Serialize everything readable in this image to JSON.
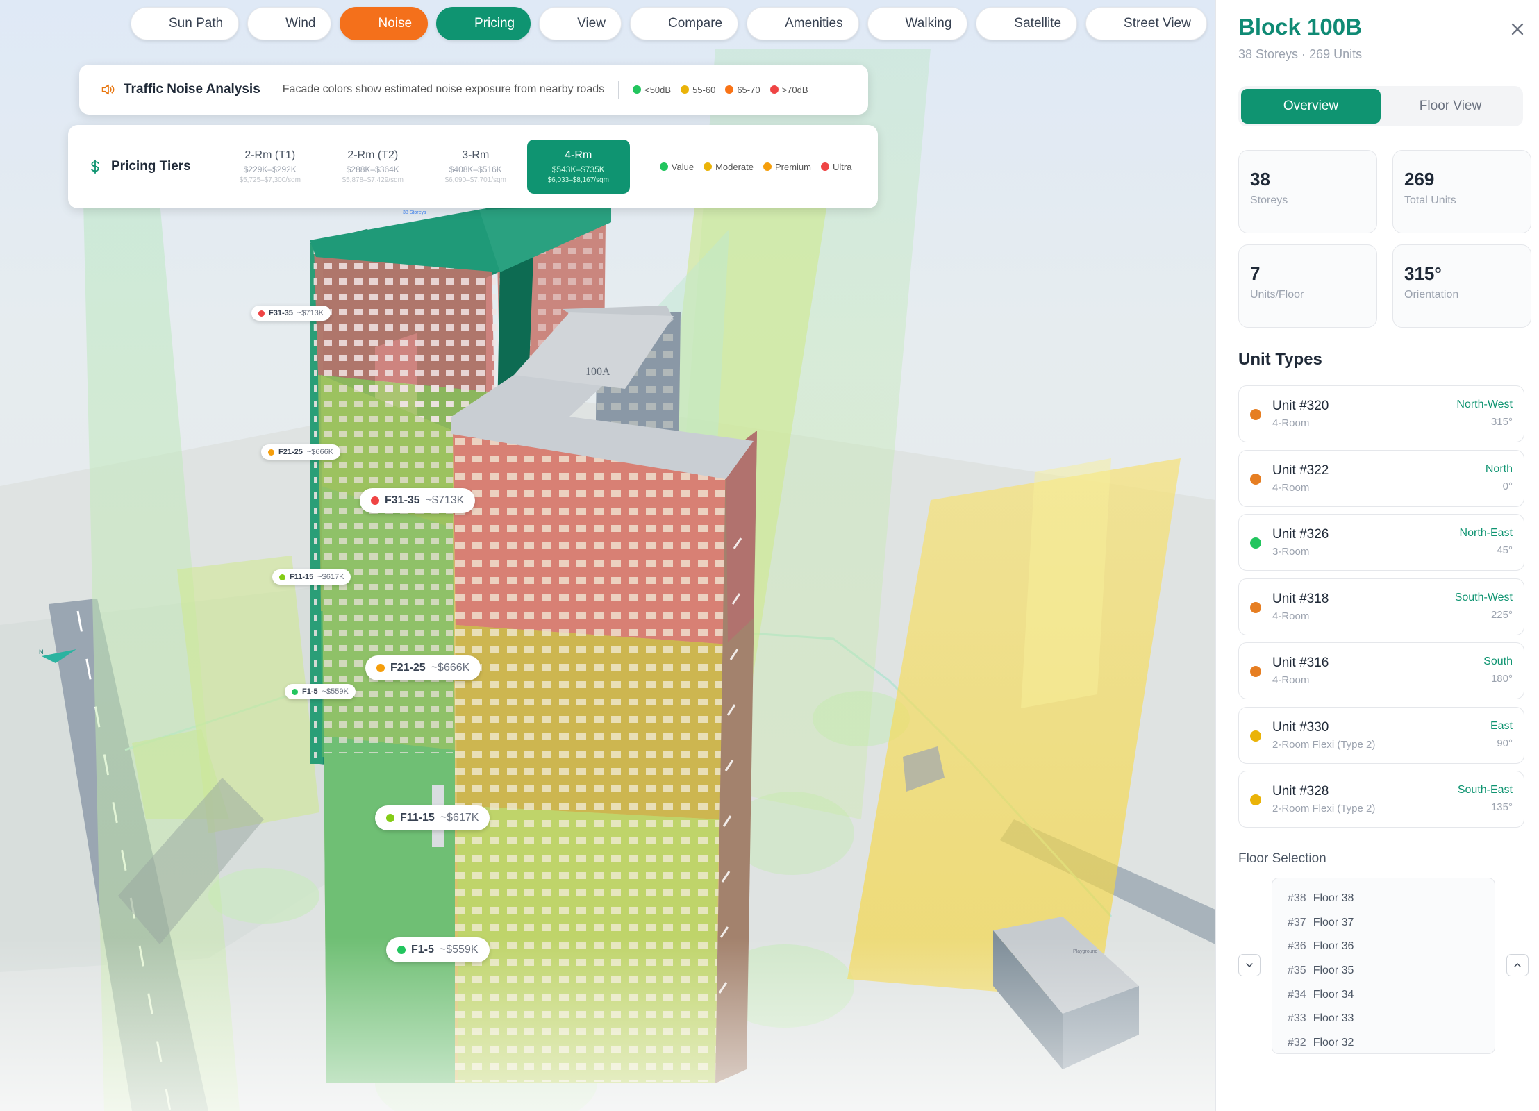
{
  "toolbar": {
    "buttons": [
      {
        "label": "Sun Path",
        "icon": "sun-icon"
      },
      {
        "label": "Wind",
        "icon": "wind-icon"
      },
      {
        "label": "Noise",
        "icon": "speaker-icon",
        "active_color": "#f4701b"
      },
      {
        "label": "Pricing",
        "icon": "dollar-icon",
        "active_color": "#0f9471"
      },
      {
        "label": "View",
        "icon": "binoculars-icon"
      },
      {
        "label": "Compare",
        "icon": "compare-arrows-icon"
      },
      {
        "label": "Amenities",
        "icon": "user-pin-icon"
      },
      {
        "label": "Walking",
        "icon": "footprints-icon"
      },
      {
        "label": "Satellite",
        "icon": "satellite-icon"
      },
      {
        "label": "Street View",
        "icon": "eye-icon"
      }
    ]
  },
  "noise_card": {
    "title": "Traffic Noise Analysis",
    "description": "Facade colors show estimated noise exposure from nearby roads",
    "legend": [
      {
        "label": "<50dB",
        "color": "#22c55e"
      },
      {
        "label": "55-60",
        "color": "#eab308"
      },
      {
        "label": "65-70",
        "color": "#f97316"
      },
      {
        "label": ">70dB",
        "color": "#ef4444"
      }
    ]
  },
  "pricing_card": {
    "title": "Pricing Tiers",
    "tiers": [
      {
        "name": "2-Rm (T1)",
        "price": "$229K–$292K",
        "psf": "$5,725–$7,300/sqm",
        "active": false
      },
      {
        "name": "2-Rm (T2)",
        "price": "$288K–$364K",
        "psf": "$5,878–$7,429/sqm",
        "active": false
      },
      {
        "name": "3-Rm",
        "price": "$408K–$516K",
        "psf": "$6,090–$7,701/sqm",
        "active": false
      },
      {
        "name": "4-Rm",
        "price": "$543K–$735K",
        "psf": "$6,033–$8,167/sqm",
        "active": true
      }
    ],
    "legend": [
      {
        "label": "Value",
        "color": "#22c55e"
      },
      {
        "label": "Moderate",
        "color": "#eab308"
      },
      {
        "label": "Premium",
        "color": "#f59e0b"
      },
      {
        "label": "Ultra",
        "color": "#ef4444"
      }
    ]
  },
  "scene": {
    "block_sign_100a": "100A",
    "tower_top_label": "38 Storeys",
    "floor_labels": [
      {
        "floors": "F31-35",
        "price": "~$713K",
        "color": "#ef4444",
        "size": "sm"
      },
      {
        "floors": "F21-25",
        "price": "~$666K",
        "color": "#f59e0b",
        "size": "sm"
      },
      {
        "floors": "F31-35",
        "price": "~$713K",
        "color": "#ef4444",
        "size": "lg"
      },
      {
        "floors": "F11-15",
        "price": "~$617K",
        "color": "#84cc16",
        "size": "sm"
      },
      {
        "floors": "F21-25",
        "price": "~$666K",
        "color": "#f59e0b",
        "size": "lg"
      },
      {
        "floors": "F1-5",
        "price": "~$559K",
        "color": "#22c55e",
        "size": "sm"
      },
      {
        "floors": "F11-15",
        "price": "~$617K",
        "color": "#84cc16",
        "size": "lg"
      },
      {
        "floors": "F1-5",
        "price": "~$559K",
        "color": "#22c55e",
        "size": "lg"
      }
    ]
  },
  "panel": {
    "title": "Block 100B",
    "subtitle": "38 Storeys · 269 Units",
    "tabs": [
      "Overview",
      "Floor View"
    ],
    "stats": [
      {
        "value": "38",
        "label": "Storeys",
        "icon": "building-icon"
      },
      {
        "value": "269",
        "label": "Total Units",
        "icon": "home-icon"
      },
      {
        "value": "7",
        "label": "Units/Floor",
        "icon": "layers-icon"
      },
      {
        "value": "315°",
        "label": "Orientation",
        "icon": "compass-icon"
      }
    ],
    "unit_types_title": "Unit Types",
    "units": [
      {
        "name": "Unit #320",
        "type": "4-Room",
        "direction": "North-West",
        "degrees": "315°",
        "color": "#e67e22"
      },
      {
        "name": "Unit #322",
        "type": "4-Room",
        "direction": "North",
        "degrees": "0°",
        "color": "#e67e22"
      },
      {
        "name": "Unit #326",
        "type": "3-Room",
        "direction": "North-East",
        "degrees": "45°",
        "color": "#22c55e"
      },
      {
        "name": "Unit #318",
        "type": "4-Room",
        "direction": "South-West",
        "degrees": "225°",
        "color": "#e67e22"
      },
      {
        "name": "Unit #316",
        "type": "4-Room",
        "direction": "South",
        "degrees": "180°",
        "color": "#e67e22"
      },
      {
        "name": "Unit #330",
        "type": "2-Room Flexi (Type 2)",
        "direction": "East",
        "degrees": "90°",
        "color": "#eab308"
      },
      {
        "name": "Unit #328",
        "type": "2-Room Flexi (Type 2)",
        "direction": "South-East",
        "degrees": "135°",
        "color": "#eab308"
      }
    ],
    "floor_selection_title": "Floor Selection",
    "floors": [
      {
        "no": "#38",
        "label": "Floor 38"
      },
      {
        "no": "#37",
        "label": "Floor 37"
      },
      {
        "no": "#36",
        "label": "Floor 36"
      },
      {
        "no": "#35",
        "label": "Floor 35"
      },
      {
        "no": "#34",
        "label": "Floor 34"
      },
      {
        "no": "#33",
        "label": "Floor 33"
      },
      {
        "no": "#32",
        "label": "Floor 32"
      }
    ]
  }
}
